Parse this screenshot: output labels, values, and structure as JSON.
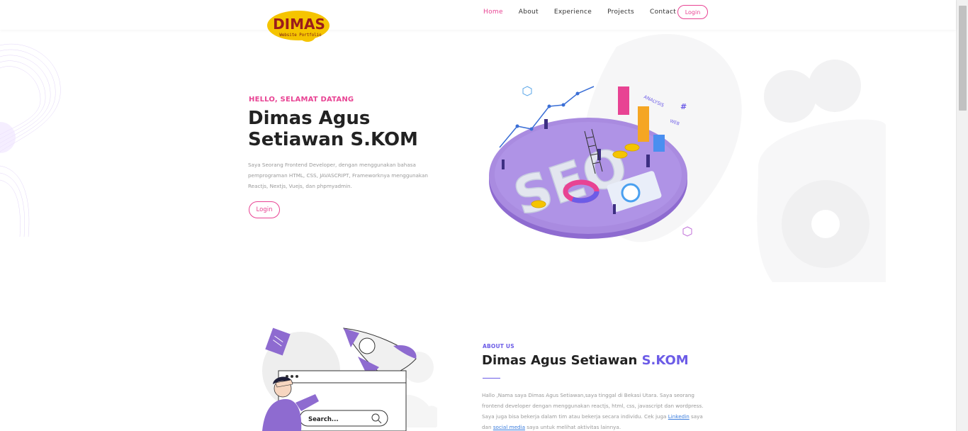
{
  "header": {
    "logo_main": "DIMAS",
    "logo_sub": "Website Portfolio",
    "nav": [
      {
        "label": "Home"
      },
      {
        "label": "About"
      },
      {
        "label": "Experience"
      },
      {
        "label": "Projects"
      },
      {
        "label": "Contact"
      }
    ],
    "login_label": "Login"
  },
  "hero": {
    "greeting": "HELLO, SELAMAT DATANG",
    "title": "Dimas Agus Setiawan S.KOM",
    "description": "Saya Seorang Frontend Developer, dengan menggunakan bahasa pemprograman HTML, CSS, JAVASCRIPT, Frameworknya menggunakan Reactjs, Nextjs, Vuejs, dan phpmyadmin.",
    "button_label": "Login",
    "illustration_text": "SEO",
    "illustration_tag_analysis": "ANALYSIS",
    "illustration_tag_web": "WEB",
    "illustration_tag_hash": "#"
  },
  "about": {
    "label": "ABOUT US",
    "title_main": "Dimas Agus Setiawan ",
    "title_accent": "S.KOM",
    "text_part1": "Hallo ,Nama saya Dimas Agus Setiawan,saya tinggal di Bekasi Utara. Saya seorang frontend developer dengan menggunakan reactjs, html, css, javascript dan wordpress. Saya juga bisa bekerja dalam tim atau bekerja secara individu. Cek juga ",
    "link_linkedin": "Linkedin",
    "text_part2": " saya dan ",
    "link_social": "social media",
    "text_part3": " saya untuk melihat aktivitas lainnya.",
    "search_placeholder": "Search..."
  }
}
